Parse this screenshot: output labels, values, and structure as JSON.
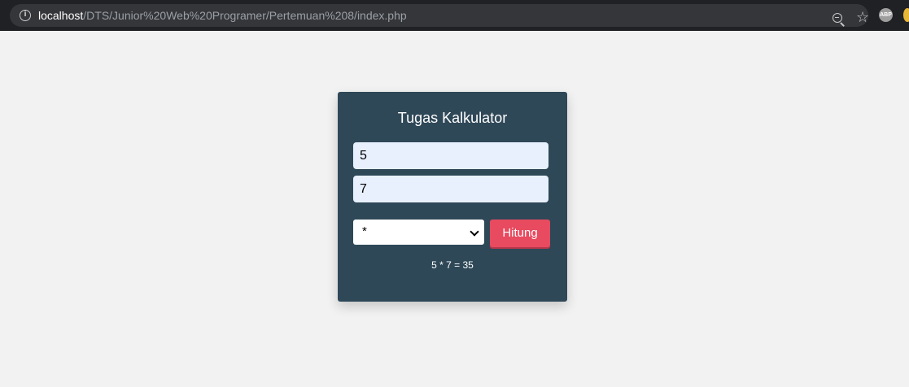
{
  "browser": {
    "url_host": "localhost",
    "url_path": "/DTS/Junior%20Web%20Programer/Pertemuan%208/index.php",
    "info_icon": "info-icon",
    "zoom_icon": "zoom-out-icon",
    "star_icon": "bookmark-star-icon",
    "extension_label": "ABP"
  },
  "calculator": {
    "title": "Tugas Kalkulator",
    "input_a": "5",
    "input_b": "7",
    "operator_selected": "*",
    "submit_label": "Hitung",
    "result_text": "5 * 7 = 35"
  },
  "colors": {
    "card_bg": "#2f4858",
    "button_bg": "#e84a5f",
    "page_bg": "#f2f2f2",
    "input_bg": "#e8f0fe"
  }
}
